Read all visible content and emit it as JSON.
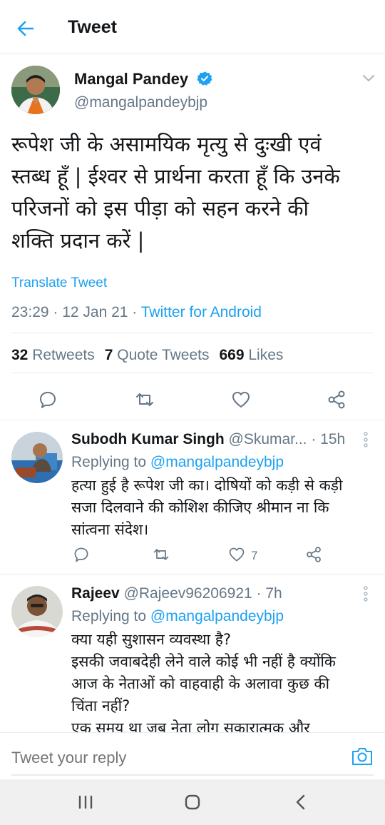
{
  "header": {
    "title": "Tweet"
  },
  "main_tweet": {
    "author_name": "Mangal Pandey",
    "author_handle": "@mangalpandeybjp",
    "text_lines": [
      "रूपेश जी के असामयिक मृत्यु से दुःखी एवं",
      "स्तब्ध हूँ | ईश्वर से प्रार्थना करता हूँ कि उनके",
      "परिजनों को इस पीड़ा को सहन करने की",
      "शक्ति प्रदान करें |"
    ],
    "translate_label": "Translate Tweet",
    "timestamp": "23:29 · 12 Jan 21 · ",
    "source": "Twitter for Android",
    "stats": {
      "retweets_count": "32",
      "retweets_label": "Retweets",
      "quote_count": "7",
      "quote_label": "Quote Tweets",
      "likes_count": "669",
      "likes_label": "Likes"
    }
  },
  "replies": [
    {
      "name": "Subodh Kumar Singh",
      "handle_time": "@Skumar... · 15h",
      "replying_prefix": "Replying to ",
      "replying_to": "@mangalpandeybjp",
      "text_lines": [
        "हत्या हुई है रूपेश जी का। दोषियों को कड़ी से कड़ी",
        "सजा दिलवाने की कोशिश कीजिए श्रीमान ना कि",
        "सांत्वना संदेश।"
      ],
      "like_count": "7"
    },
    {
      "name": "Rajeev",
      "handle_time": "@Rajeev96206921 · 7h",
      "replying_prefix": "Replying to ",
      "replying_to": "@mangalpandeybjp",
      "text_lines": [
        "क्या यही सुशासन व्यवस्था है?",
        "इसकी जवाबदेही लेने वाले कोई भी नहीं है क्योंकि",
        "आज के नेताओं को वाहवाही के अलावा कुछ की",
        "चिंता नहीं?",
        "एक समय था जब नेता लोग सकारात्मक और"
      ]
    }
  ],
  "reply_bar": {
    "placeholder": "Tweet your reply"
  },
  "icons": {
    "back": "arrow-left-icon",
    "verified": "verified-badge-icon",
    "reply": "comment-icon",
    "retweet": "retweet-icon",
    "like": "heart-icon",
    "share": "share-icon",
    "camera": "camera-icon"
  },
  "colors": {
    "accent": "#1da1f2",
    "muted": "#657786",
    "text": "#14171a"
  }
}
